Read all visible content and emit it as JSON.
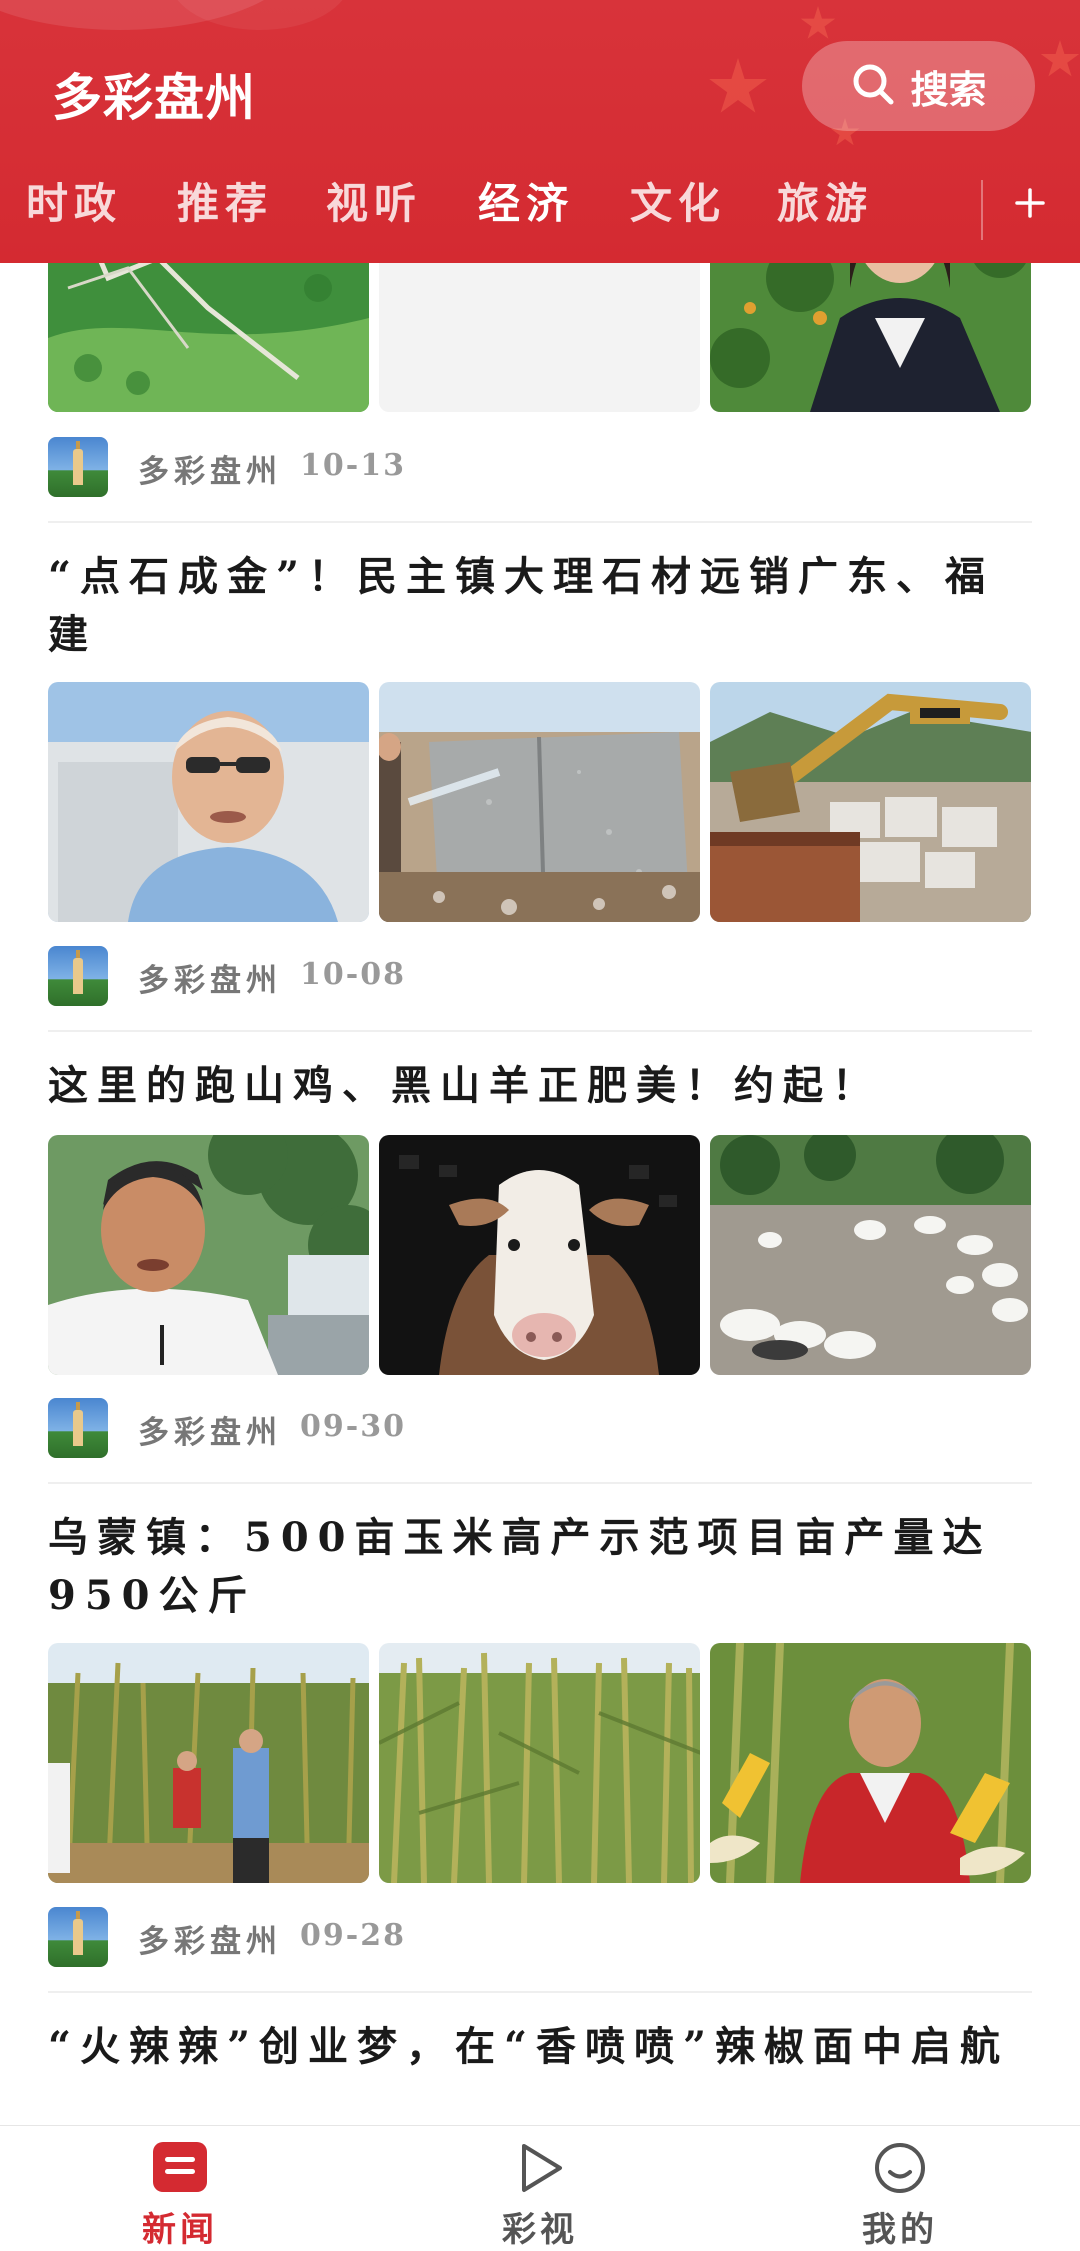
{
  "header": {
    "app_title": "多彩盘州",
    "search_label": "搜索",
    "search_icon": "search-icon",
    "add_channel_icon": "plus-icon",
    "tabs": [
      {
        "label": "时政",
        "active": false
      },
      {
        "label": "推荐",
        "active": false
      },
      {
        "label": "视听",
        "active": false
      },
      {
        "label": "经济",
        "active": true
      },
      {
        "label": "文化",
        "active": false
      },
      {
        "label": "旅游",
        "active": false
      }
    ]
  },
  "feed": {
    "articles": [
      {
        "title": "",
        "source": "多彩盘州",
        "date": "10-13"
      },
      {
        "title": "“点石成金”！民主镇大理石材远销广东、福建",
        "source": "多彩盘州",
        "date": "10-08"
      },
      {
        "title": "这里的跑山鸡、黑山羊正肥美！约起！",
        "source": "多彩盘州",
        "date": "09-30"
      },
      {
        "title": "乌蒙镇：500亩玉米高产示范项目亩产量达950公斤",
        "source": "多彩盘州",
        "date": "09-28"
      },
      {
        "title": "“火辣辣”创业梦，在“香喷喷”辣椒面中启航",
        "source": "",
        "date": ""
      }
    ]
  },
  "bottom_nav": {
    "items": [
      {
        "label": "新闻",
        "icon": "news-icon",
        "active": true
      },
      {
        "label": "彩视",
        "icon": "play-icon",
        "active": false
      },
      {
        "label": "我的",
        "icon": "smiley-face-icon",
        "active": false
      }
    ],
    "active_color": "#d42a31"
  },
  "colors": {
    "brand_red": "#d42a31",
    "text_dark": "#1a1a1a",
    "meta_gray": "#999999"
  }
}
